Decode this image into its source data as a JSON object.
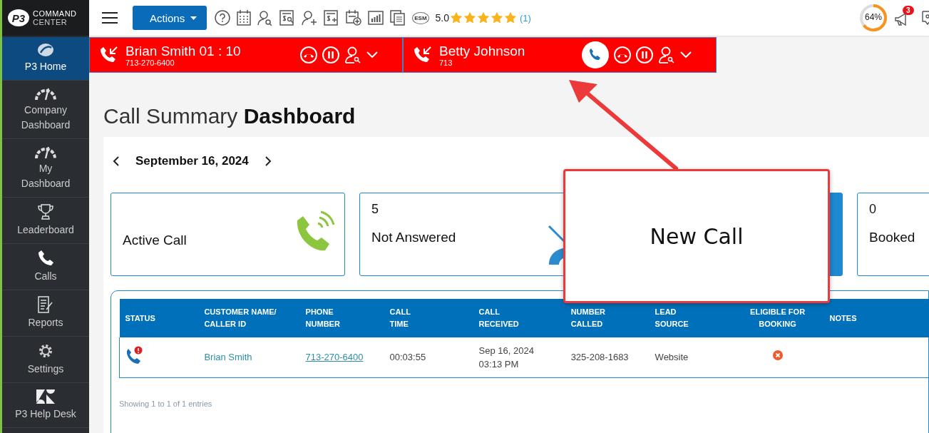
{
  "logo": {
    "mark": "P3",
    "line1": "COMMAND",
    "line2": "CENTER"
  },
  "toolbar": {
    "actions_label": "Actions",
    "esm": "ESM",
    "rating": "5.0",
    "stars": 5,
    "rating_count": "(1)",
    "progress": {
      "level": 0.64,
      "label": "64%"
    },
    "notifications": "3"
  },
  "sidebar": {
    "items": [
      {
        "label": "P3 Home",
        "kind": "home",
        "selected": true
      },
      {
        "label": "Company Dashboard",
        "kind": "gauge",
        "selected": false
      },
      {
        "label": "My Dashboard",
        "kind": "gauge",
        "selected": false
      },
      {
        "label": "Leaderboard",
        "kind": "trophy",
        "selected": false
      },
      {
        "label": "Calls",
        "kind": "phone",
        "selected": false
      },
      {
        "label": "Reports",
        "kind": "report",
        "selected": false
      },
      {
        "label": "Settings",
        "kind": "gear",
        "selected": false
      },
      {
        "label": "P3 Help Desk",
        "kind": "helpdesk",
        "selected": false
      }
    ]
  },
  "calls": [
    {
      "title": "Brian Smith 01 : 10",
      "number": "713-270-6400",
      "ringing": false
    },
    {
      "title": "Betty Johnson",
      "number": "713",
      "ringing": true
    }
  ],
  "page_title": "Call Summary **Dashboard**",
  "date": "September 16, 2024",
  "cards": [
    {
      "kind": "active",
      "label": "Active Call"
    },
    {
      "kind": "missed",
      "count": "5",
      "label": "Not Answered"
    },
    {
      "kind": "highlight"
    },
    {
      "kind": "plain",
      "count": "0",
      "label": "Booked"
    }
  ],
  "table": {
    "columns": [
      [
        "STATUS"
      ],
      [
        "CUSTOMER NAME/",
        "CALLER ID"
      ],
      [
        "PHONE",
        "NUMBER"
      ],
      [
        "CALL",
        "TIME"
      ],
      [
        "CALL",
        "RECEIVED"
      ],
      [
        "NUMBER",
        "CALLED"
      ],
      [
        "LEAD",
        "SOURCE"
      ],
      [
        "ELIGIBLE FOR",
        "BOOKING"
      ],
      [
        "NOTES"
      ]
    ],
    "rows": [
      {
        "kind": "missed",
        "customer": "Brian Smith",
        "phone": "713-270-6400",
        "call_time": "00:03:55",
        "received": [
          "Sep 16, 2024",
          "03:13 PM"
        ],
        "number_called": "325-208-1683",
        "lead_source": "Website",
        "eligible": false
      }
    ],
    "footer": "Showing 1 to 1 of 1 entries"
  },
  "callout": {
    "text": "New Call"
  }
}
